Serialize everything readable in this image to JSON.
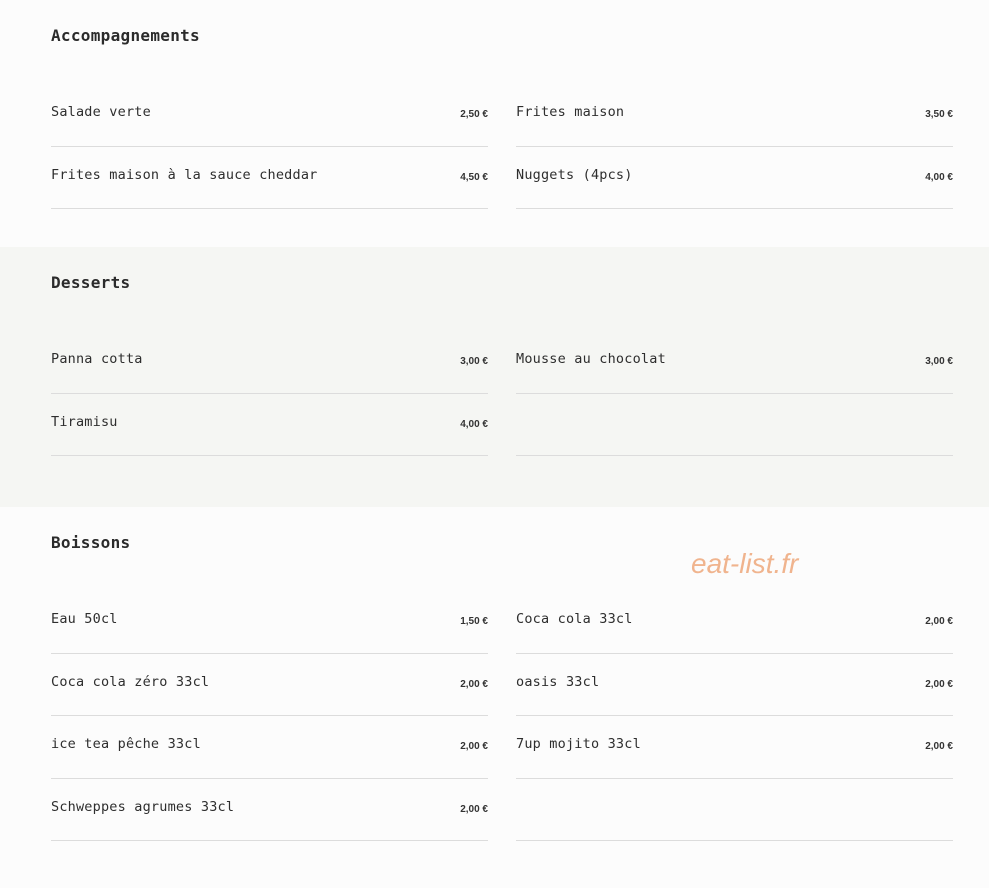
{
  "sections": [
    {
      "id": "accomp",
      "title": "Accompagnements",
      "items": [
        {
          "name": "Salade verte",
          "price": "2,50 €"
        },
        {
          "name": "Frites maison",
          "price": "3,50 €"
        },
        {
          "name": "Frites maison à la sauce cheddar",
          "price": "4,50 €"
        },
        {
          "name": "Nuggets (4pcs)",
          "price": "4,00 €"
        }
      ]
    },
    {
      "id": "desserts",
      "title": "Desserts",
      "items": [
        {
          "name": "Panna cotta",
          "price": "3,00 €"
        },
        {
          "name": "Mousse au chocolat",
          "price": "3,00 €"
        },
        {
          "name": "Tiramisu",
          "price": "4,00 €"
        }
      ]
    },
    {
      "id": "boissons",
      "title": "Boissons",
      "items": [
        {
          "name": "Eau 50cl",
          "price": "1,50 €"
        },
        {
          "name": "Coca cola 33cl",
          "price": "2,00 €"
        },
        {
          "name": "Coca cola zéro 33cl",
          "price": "2,00 €"
        },
        {
          "name": "oasis 33cl",
          "price": "2,00 €"
        },
        {
          "name": "ice tea pêche 33cl",
          "price": "2,00 €"
        },
        {
          "name": "7up mojito 33cl",
          "price": "2,00 €"
        },
        {
          "name": "Schweppes agrumes 33cl",
          "price": "2,00 €"
        }
      ]
    }
  ],
  "watermark": "eat-list.fr",
  "colors": {
    "background": "#fcfcfc",
    "alt_section_background": "#f5f6f3",
    "watermark": "#f0b48e",
    "divider": "#dcdcdc"
  }
}
